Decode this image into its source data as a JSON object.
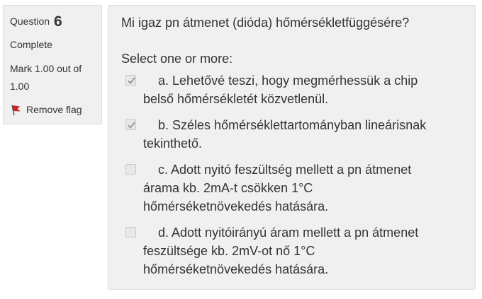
{
  "info": {
    "question_label": "Question",
    "question_number": "6",
    "state": "Complete",
    "grade_line1": "Mark 1.00 out of",
    "grade_line2": "1.00",
    "flag_label": "Remove flag",
    "flag_icon": "flag-icon",
    "flag_color": "#cc2222"
  },
  "question": {
    "text": "Mi igaz pn átmenet (dióda) hőmérsékletfüggésére?",
    "prompt": "Select one or more:"
  },
  "options": [
    {
      "letter": "a.",
      "line1": "Lehetővé teszi, hogy megmérhessük a chip",
      "line2": "belső hőmérsékletét közvetlenül.",
      "line3": "",
      "checked": true
    },
    {
      "letter": "b.",
      "line1": "Széles hőmérséklettartományban lineárisnak",
      "line2": "tekinthető.",
      "line3": "",
      "checked": true
    },
    {
      "letter": "c.",
      "line1": "Adott nyitó feszültség mellett a pn átmenet",
      "line2": "árama kb. 2mA-t csökken 1°C",
      "line3": "hőmérséketnövekedés hatására.",
      "checked": false
    },
    {
      "letter": "d.",
      "line1": "Adott nyitóirányú áram mellett a pn átmenet",
      "line2": "feszültsége kb. 2mV-ot nő 1°C",
      "line3": "hőmérséketnövekedés hatására.",
      "checked": false
    }
  ],
  "colors": {
    "panel_bg": "#f0f0f0",
    "panel_border": "#dddddd",
    "text": "#333333",
    "check": "#9a9a9a"
  }
}
